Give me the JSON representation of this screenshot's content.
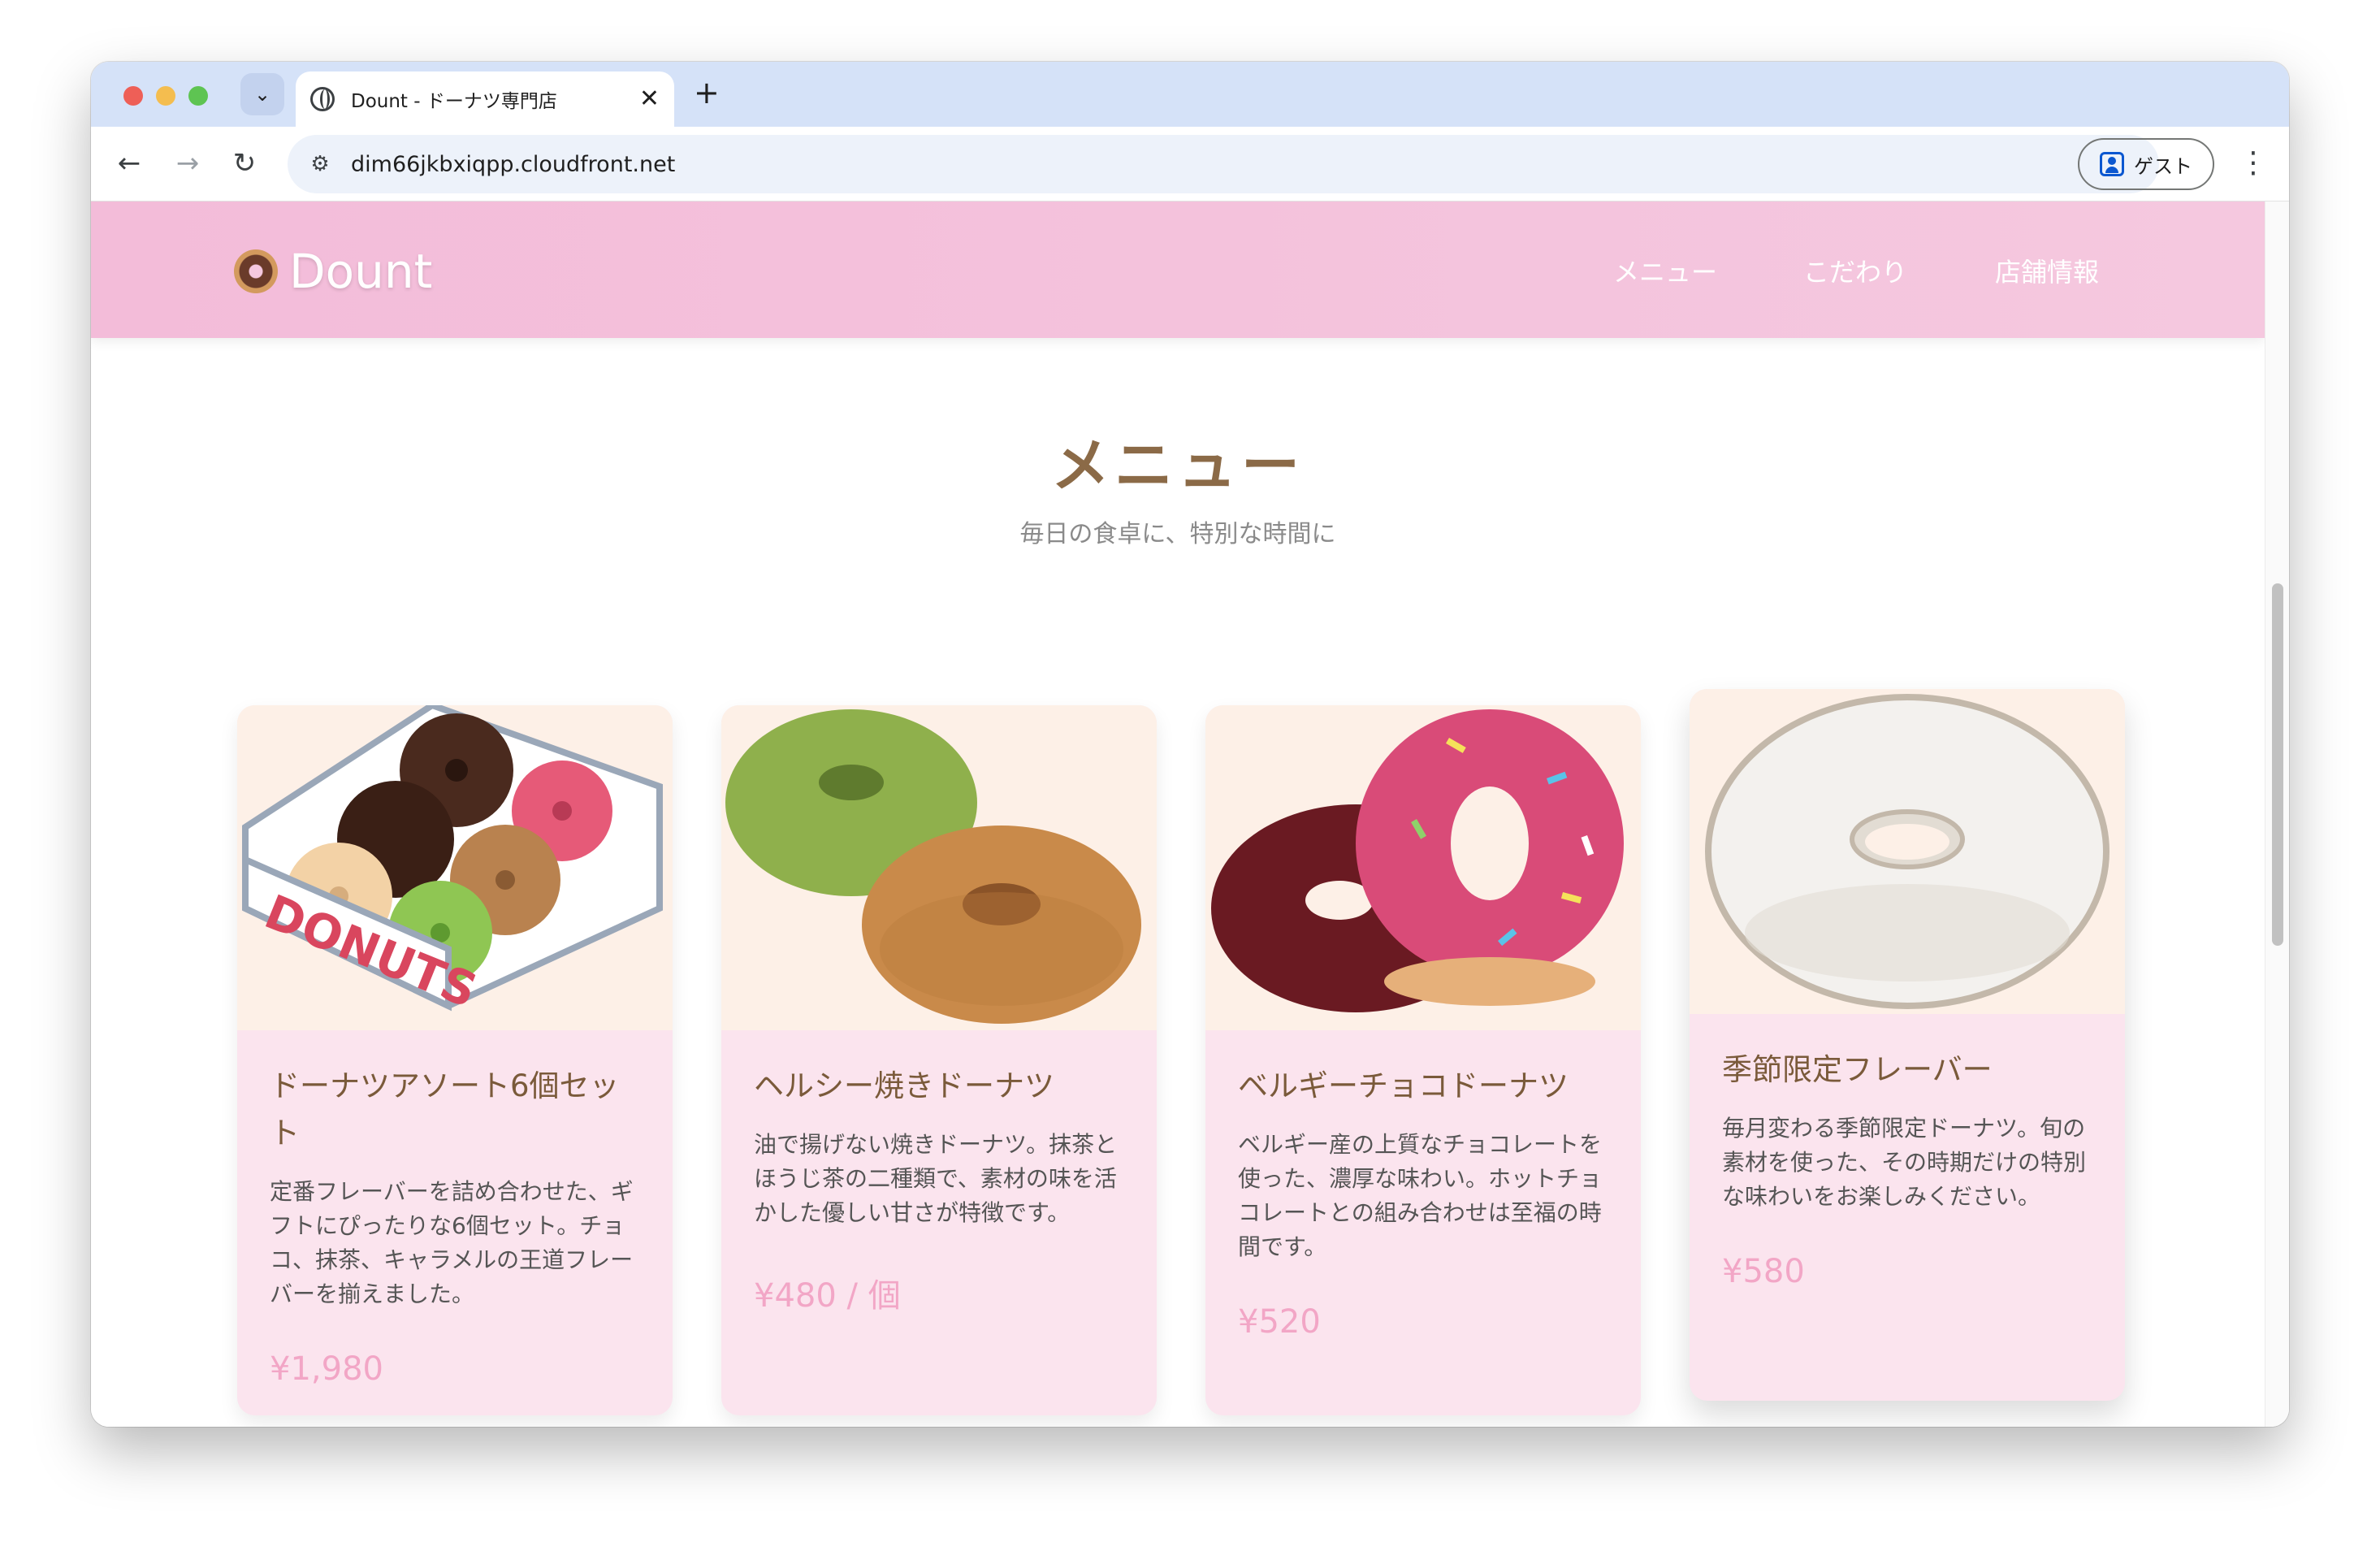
{
  "browser": {
    "tab_title": "Dount - ドーナツ専門店",
    "url": "dim66jkbxiqpp.cloudfront.net",
    "profile_label": "ゲスト"
  },
  "site": {
    "logo_text": "Dount",
    "nav": [
      "メニュー",
      "こだわり",
      "店舗情報"
    ]
  },
  "menu": {
    "title": "メニュー",
    "subtitle": "毎日の食卓に、特別な時間に",
    "items": [
      {
        "name": "ドーナツアソート6個セット",
        "desc": "定番フレーバーを詰め合わせた、ギフトにぴったりな6個セット。チョコ、抹茶、キャラメルの王道フレーバーを揃えました。",
        "price": "¥1,980",
        "image_label": "DONUTS"
      },
      {
        "name": "ヘルシー焼きドーナツ",
        "desc": "油で揚げない焼きドーナツ。抹茶とほうじ茶の二種類で、素材の味を活かした優しい甘さが特徴です。",
        "price": "¥480 / 個"
      },
      {
        "name": "ベルギーチョコドーナツ",
        "desc": "ベルギー産の上質なチョコレートを使った、濃厚な味わい。ホットチョコレートとの組み合わせは至福の時間です。",
        "price": "¥520"
      },
      {
        "name": "季節限定フレーバー",
        "desc": "毎月変わる季節限定ドーナツ。旬の素材を使った、その時期だけの特別な味わいをお楽しみください。",
        "price": "¥580"
      }
    ]
  },
  "colors": {
    "header_pink": "#f3bcd9",
    "card_bg": "#fbe4ee",
    "title_brown": "#8b6a47",
    "price_pink": "#f2a6c6"
  }
}
